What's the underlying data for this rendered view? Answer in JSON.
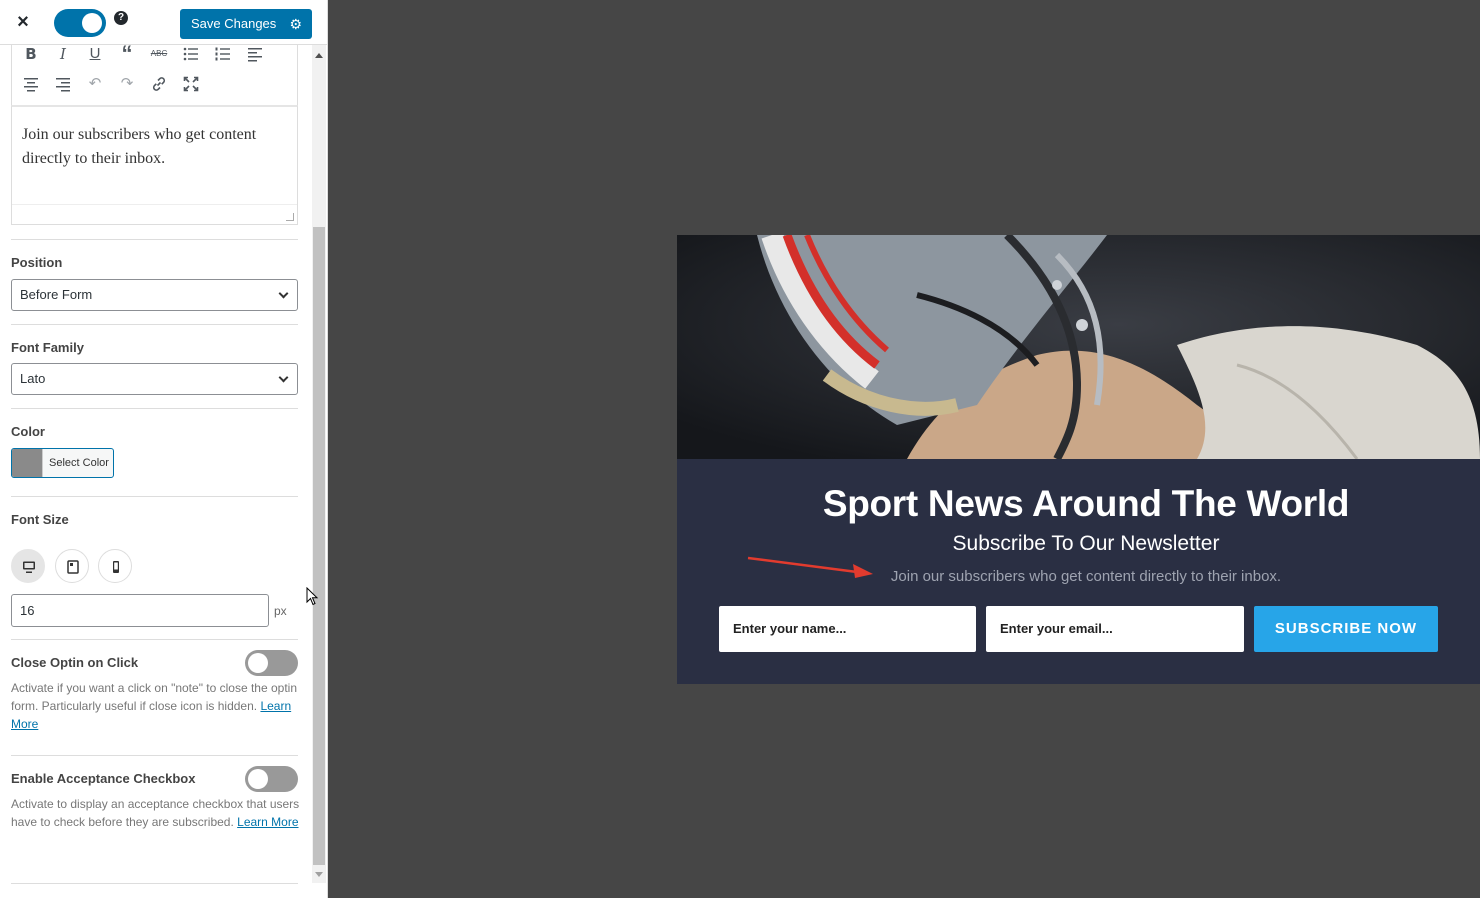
{
  "header": {
    "save_label": "Save Changes",
    "help": "?",
    "close": "×"
  },
  "editor": {
    "content": "Join our subscribers who get content directly to their inbox."
  },
  "fields": {
    "position_label": "Position",
    "position_value": "Before Form",
    "font_family_label": "Font Family",
    "font_family_value": "Lato",
    "color_label": "Color",
    "color_button": "Select Color",
    "color_value": "#8a8a8a",
    "font_size_label": "Font Size",
    "font_size_value": "16",
    "font_size_unit": "px",
    "close_optin_label": "Close Optin on Click",
    "close_optin_desc": "Activate if you want a click on \"note\" to close the optin form. Particularly useful if close icon is hidden.",
    "acceptance_label": "Enable Acceptance Checkbox",
    "acceptance_desc": "Activate to display an acceptance checkbox that users have to check before they are subscribed.",
    "learn_more": "Learn More"
  },
  "preview": {
    "title": "Sport News Around The World",
    "subtitle": "Subscribe To Our Newsletter",
    "note": "Join our subscribers who get content directly to their inbox.",
    "name_placeholder": "Enter your name...",
    "email_placeholder": "Enter your email...",
    "button": "SUBSCRIBE NOW"
  },
  "colors": {
    "accent": "#0073aa",
    "optin_bg": "#2a2f43",
    "subscribe_btn": "#27a5e8",
    "arrow": "#e23b2e"
  }
}
